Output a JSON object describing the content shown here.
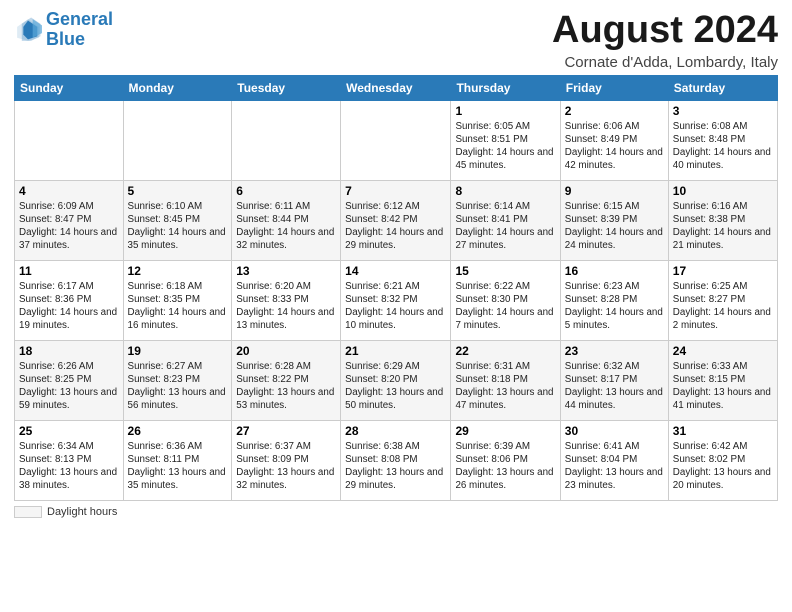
{
  "logo": {
    "line1": "General",
    "line2": "Blue"
  },
  "title": "August 2024",
  "subtitle": "Cornate d'Adda, Lombardy, Italy",
  "days_of_week": [
    "Sunday",
    "Monday",
    "Tuesday",
    "Wednesday",
    "Thursday",
    "Friday",
    "Saturday"
  ],
  "weeks": [
    [
      {
        "day": "",
        "info": ""
      },
      {
        "day": "",
        "info": ""
      },
      {
        "day": "",
        "info": ""
      },
      {
        "day": "",
        "info": ""
      },
      {
        "day": "1",
        "info": "Sunrise: 6:05 AM\nSunset: 8:51 PM\nDaylight: 14 hours and 45 minutes."
      },
      {
        "day": "2",
        "info": "Sunrise: 6:06 AM\nSunset: 8:49 PM\nDaylight: 14 hours and 42 minutes."
      },
      {
        "day": "3",
        "info": "Sunrise: 6:08 AM\nSunset: 8:48 PM\nDaylight: 14 hours and 40 minutes."
      }
    ],
    [
      {
        "day": "4",
        "info": "Sunrise: 6:09 AM\nSunset: 8:47 PM\nDaylight: 14 hours and 37 minutes."
      },
      {
        "day": "5",
        "info": "Sunrise: 6:10 AM\nSunset: 8:45 PM\nDaylight: 14 hours and 35 minutes."
      },
      {
        "day": "6",
        "info": "Sunrise: 6:11 AM\nSunset: 8:44 PM\nDaylight: 14 hours and 32 minutes."
      },
      {
        "day": "7",
        "info": "Sunrise: 6:12 AM\nSunset: 8:42 PM\nDaylight: 14 hours and 29 minutes."
      },
      {
        "day": "8",
        "info": "Sunrise: 6:14 AM\nSunset: 8:41 PM\nDaylight: 14 hours and 27 minutes."
      },
      {
        "day": "9",
        "info": "Sunrise: 6:15 AM\nSunset: 8:39 PM\nDaylight: 14 hours and 24 minutes."
      },
      {
        "day": "10",
        "info": "Sunrise: 6:16 AM\nSunset: 8:38 PM\nDaylight: 14 hours and 21 minutes."
      }
    ],
    [
      {
        "day": "11",
        "info": "Sunrise: 6:17 AM\nSunset: 8:36 PM\nDaylight: 14 hours and 19 minutes."
      },
      {
        "day": "12",
        "info": "Sunrise: 6:18 AM\nSunset: 8:35 PM\nDaylight: 14 hours and 16 minutes."
      },
      {
        "day": "13",
        "info": "Sunrise: 6:20 AM\nSunset: 8:33 PM\nDaylight: 14 hours and 13 minutes."
      },
      {
        "day": "14",
        "info": "Sunrise: 6:21 AM\nSunset: 8:32 PM\nDaylight: 14 hours and 10 minutes."
      },
      {
        "day": "15",
        "info": "Sunrise: 6:22 AM\nSunset: 8:30 PM\nDaylight: 14 hours and 7 minutes."
      },
      {
        "day": "16",
        "info": "Sunrise: 6:23 AM\nSunset: 8:28 PM\nDaylight: 14 hours and 5 minutes."
      },
      {
        "day": "17",
        "info": "Sunrise: 6:25 AM\nSunset: 8:27 PM\nDaylight: 14 hours and 2 minutes."
      }
    ],
    [
      {
        "day": "18",
        "info": "Sunrise: 6:26 AM\nSunset: 8:25 PM\nDaylight: 13 hours and 59 minutes."
      },
      {
        "day": "19",
        "info": "Sunrise: 6:27 AM\nSunset: 8:23 PM\nDaylight: 13 hours and 56 minutes."
      },
      {
        "day": "20",
        "info": "Sunrise: 6:28 AM\nSunset: 8:22 PM\nDaylight: 13 hours and 53 minutes."
      },
      {
        "day": "21",
        "info": "Sunrise: 6:29 AM\nSunset: 8:20 PM\nDaylight: 13 hours and 50 minutes."
      },
      {
        "day": "22",
        "info": "Sunrise: 6:31 AM\nSunset: 8:18 PM\nDaylight: 13 hours and 47 minutes."
      },
      {
        "day": "23",
        "info": "Sunrise: 6:32 AM\nSunset: 8:17 PM\nDaylight: 13 hours and 44 minutes."
      },
      {
        "day": "24",
        "info": "Sunrise: 6:33 AM\nSunset: 8:15 PM\nDaylight: 13 hours and 41 minutes."
      }
    ],
    [
      {
        "day": "25",
        "info": "Sunrise: 6:34 AM\nSunset: 8:13 PM\nDaylight: 13 hours and 38 minutes."
      },
      {
        "day": "26",
        "info": "Sunrise: 6:36 AM\nSunset: 8:11 PM\nDaylight: 13 hours and 35 minutes."
      },
      {
        "day": "27",
        "info": "Sunrise: 6:37 AM\nSunset: 8:09 PM\nDaylight: 13 hours and 32 minutes."
      },
      {
        "day": "28",
        "info": "Sunrise: 6:38 AM\nSunset: 8:08 PM\nDaylight: 13 hours and 29 minutes."
      },
      {
        "day": "29",
        "info": "Sunrise: 6:39 AM\nSunset: 8:06 PM\nDaylight: 13 hours and 26 minutes."
      },
      {
        "day": "30",
        "info": "Sunrise: 6:41 AM\nSunset: 8:04 PM\nDaylight: 13 hours and 23 minutes."
      },
      {
        "day": "31",
        "info": "Sunrise: 6:42 AM\nSunset: 8:02 PM\nDaylight: 13 hours and 20 minutes."
      }
    ]
  ],
  "footer": {
    "legend_label": "Daylight hours"
  }
}
